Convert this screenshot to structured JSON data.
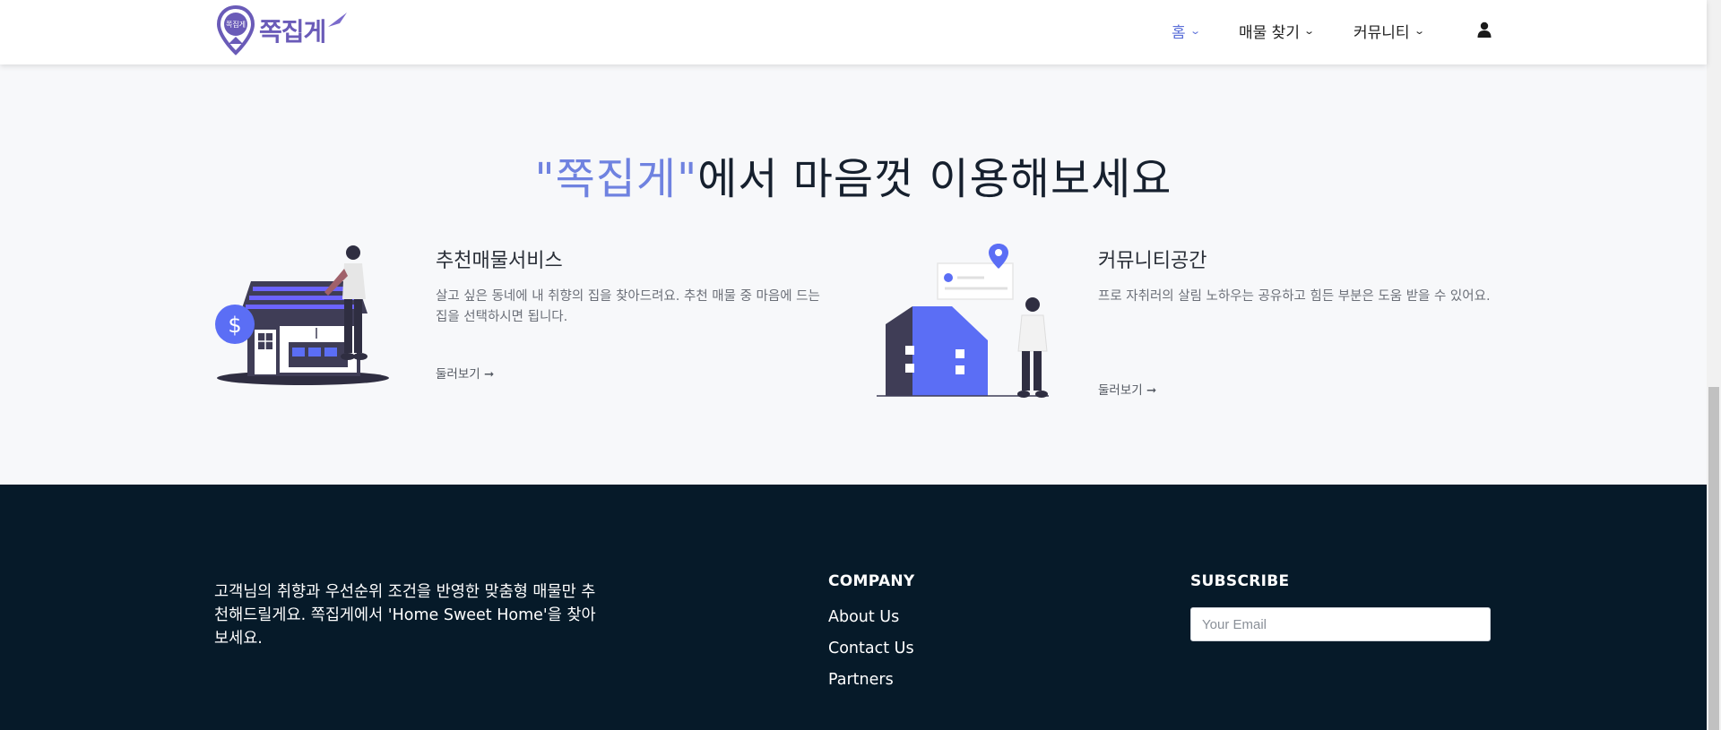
{
  "header": {
    "logo_text": "쪽집게",
    "logo_badge": "쪽집게",
    "nav": [
      {
        "label": "홈",
        "active": true
      },
      {
        "label": "매물 찾기",
        "active": false
      },
      {
        "label": "커뮤니티",
        "active": false
      }
    ],
    "user_icon": "user-icon"
  },
  "section": {
    "title_accent": "\"쪽집게\"",
    "title_rest": "에서 마음껏 이용해보세요",
    "cards": [
      {
        "title": "추천매물서비스",
        "description": "살고 싶은 동네에 내 취향의 집을 찾아드려요. 추천 매물 중 마음에 드는 집을 선택하시면 됩니다.",
        "link": "둘러보기 ➞"
      },
      {
        "title": "커뮤니티공간",
        "description": "프로 자취러의 살림 노하우는 공유하고 힘든 부분은 도움 받을 수 있어요.",
        "link": "둘러보기 ➞"
      }
    ]
  },
  "footer": {
    "about": "고객님의 취향과 우선순위 조건을 반영한 맞춤형 매물만 추천해드릴게요. 쪽집게에서 'Home Sweet Home'을 찾아보세요.",
    "company_heading": "COMPANY",
    "company_links": [
      "About Us",
      "Contact Us",
      "Partners"
    ],
    "subscribe_heading": "SUBSCRIBE",
    "email_placeholder": "Your Email"
  },
  "colors": {
    "accent": "#6f82e0",
    "footer_bg": "#061a29",
    "house_blue": "#5b6ef5",
    "house_dark": "#3f3d56"
  }
}
